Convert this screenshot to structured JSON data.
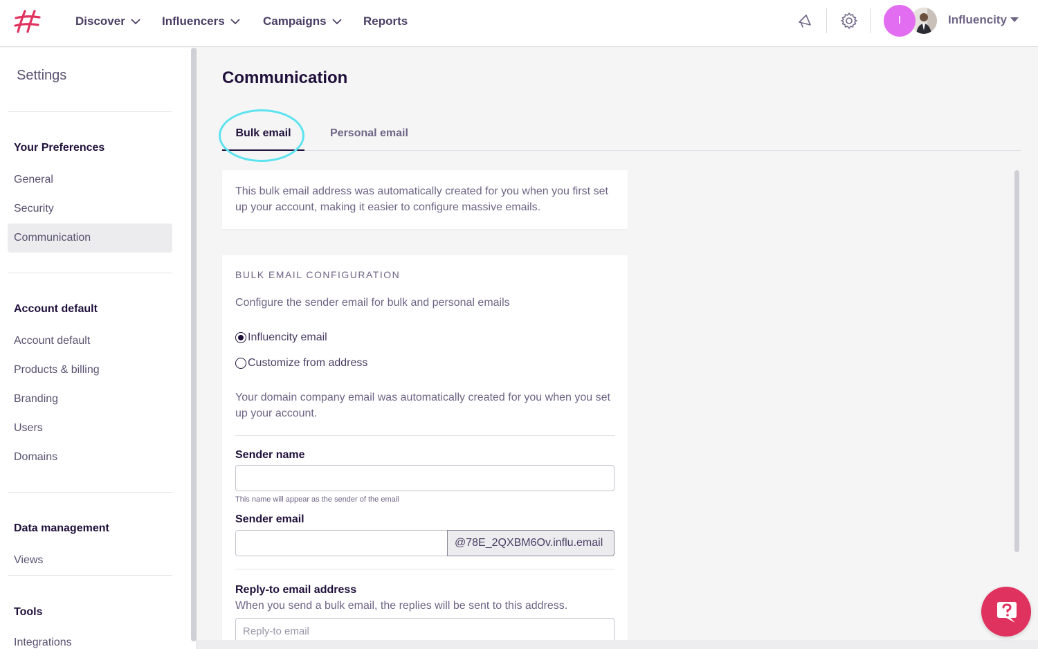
{
  "topnav": {
    "items": [
      {
        "label": "Discover"
      },
      {
        "label": "Influencers"
      },
      {
        "label": "Campaigns"
      },
      {
        "label": "Reports"
      }
    ],
    "avatar_letter": "I",
    "account_name": "Influencity",
    "icons": [
      "logo-icon",
      "announcement-icon",
      "gear-icon",
      "chevron-down-icon"
    ]
  },
  "sidebar": {
    "heading": "Settings",
    "groups": [
      {
        "title": "Your Preferences",
        "items": [
          "General",
          "Security",
          "Communication"
        ]
      },
      {
        "title": "Account default",
        "items": [
          "Account default",
          "Products & billing",
          "Branding",
          "Users",
          "Domains"
        ]
      },
      {
        "title": "Data management",
        "items": [
          "Views"
        ]
      },
      {
        "title": "Tools",
        "items": [
          "Integrations"
        ]
      }
    ],
    "active_item": "Communication"
  },
  "main": {
    "title": "Communication",
    "tabs": [
      {
        "label": "Bulk email",
        "active": true
      },
      {
        "label": "Personal email",
        "active": false
      }
    ],
    "info": "This bulk email address was automatically created for you when you first set up your account, making it easier to configure massive emails.",
    "config": {
      "title": "BULK EMAIL CONFIGURATION",
      "description": "Configure the sender email for bulk and personal emails",
      "options": [
        {
          "label": "Influencity email",
          "checked": true
        },
        {
          "label": "Customize from address",
          "checked": false
        }
      ],
      "domain_note": "Your domain company email was automatically created for you when you set up your account.",
      "sender_name_label": "Sender name",
      "sender_name_value": "",
      "sender_name_hint": "This name will appear as the sender of the email",
      "sender_email_label": "Sender email",
      "sender_email_value": "",
      "sender_email_domain": "@78E_2QXBM6Ov.influ.email",
      "reply_to_label": "Reply-to email address",
      "reply_to_help": "When you send a bulk email, the replies will be sent to this address.",
      "reply_to_placeholder": "Reply-to email"
    }
  },
  "colors": {
    "brand": "#e0325f",
    "avatar": "#e36df0",
    "highlight": "#5be3ef",
    "text_dark": "#1f0f3a"
  }
}
